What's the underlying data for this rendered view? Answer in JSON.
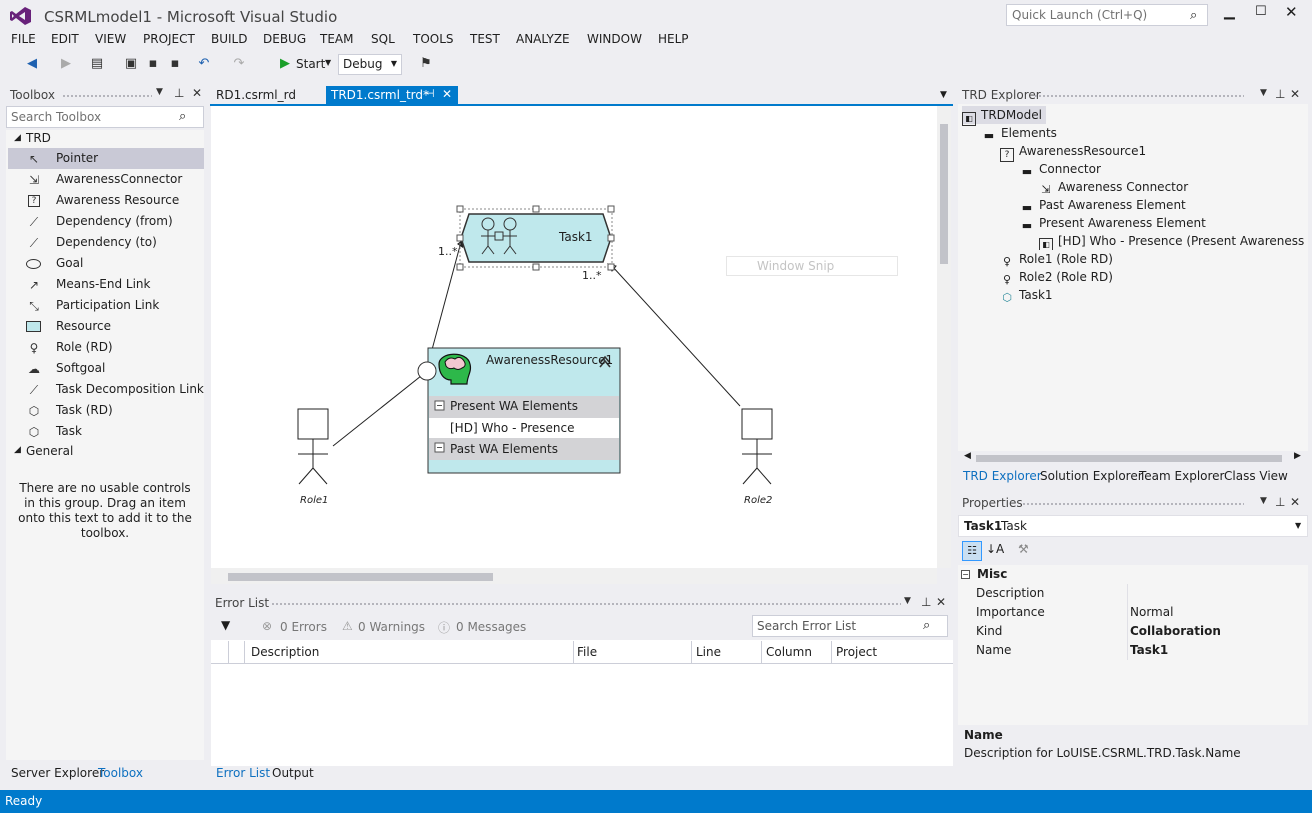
{
  "app": {
    "title": "CSRMLmodel1 - Microsoft Visual Studio",
    "quick_launch": "Quick Launch (Ctrl+Q)"
  },
  "menu": [
    "FILE",
    "EDIT",
    "VIEW",
    "PROJECT",
    "BUILD",
    "DEBUG",
    "TEAM",
    "SQL",
    "TOOLS",
    "TEST",
    "ANALYZE",
    "WINDOW",
    "HELP"
  ],
  "toolbar": {
    "start_label": "Start",
    "config": "Debug"
  },
  "toolbox": {
    "title": "Toolbox",
    "search_placeholder": "Search Toolbox",
    "group_trd": "TRD",
    "items": [
      "Pointer",
      "AwarenessConnector",
      "Awareness Resource",
      "Dependency (from)",
      "Dependency (to)",
      "Goal",
      "Means-End Link",
      "Participation Link",
      "Resource",
      "Role (RD)",
      "Softgoal",
      "Task Decomposition Link",
      "Task (RD)",
      "Task"
    ],
    "group_general": "General",
    "general_empty": "There are no usable controls in this group. Drag an item onto this text to add it to the toolbox."
  },
  "left_tabs": [
    "Server Explorer",
    "Toolbox"
  ],
  "doc_tabs": [
    "RD1.csrml_rd",
    "TRD1.csrml_trd*"
  ],
  "canvas": {
    "task_label": "Task1",
    "mult_left": "1..*",
    "mult_right": "1..*",
    "resource_title": "AwarenessResource1",
    "present_section": "Present WA Elements",
    "present_item": "[HD] Who - Presence",
    "past_section": "Past WA Elements",
    "role1": "Role1",
    "role2": "Role2",
    "ghost": "Window Snip"
  },
  "error_list": {
    "title": "Error List",
    "errors": "0 Errors",
    "warnings": "0 Warnings",
    "messages": "0 Messages",
    "search_placeholder": "Search Error List",
    "columns": [
      "Description",
      "File",
      "Line",
      "Column",
      "Project"
    ]
  },
  "bottom_tabs": [
    "Error List",
    "Output"
  ],
  "trd_explorer": {
    "title": "TRD Explorer",
    "nodes": [
      "TRDModel",
      "Elements",
      "AwarenessResource1",
      "Connector",
      "Awareness Connector",
      "Past Awareness Element",
      "Present Awareness Element",
      "[HD] Who - Presence (Present Awareness Eleme",
      "Role1 (Role RD)",
      "Role2 (Role RD)",
      "Task1"
    ]
  },
  "explorer_tabs": [
    "TRD Explorer",
    "Solution Explorer",
    "Team Explorer",
    "Class View"
  ],
  "properties": {
    "title": "Properties",
    "object_name": "Task1",
    "object_type": "Task",
    "category": "Misc",
    "rows": [
      {
        "key": "Description",
        "value": ""
      },
      {
        "key": "Importance",
        "value": "Normal"
      },
      {
        "key": "Kind",
        "value": "Collaboration"
      },
      {
        "key": "Name",
        "value": "Task1"
      }
    ],
    "desc_title": "Name",
    "desc_text": "Description for LoUISE.CSRML.TRD.Task.Name"
  },
  "status": "Ready"
}
